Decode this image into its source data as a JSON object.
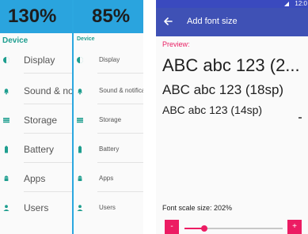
{
  "left_panels": [
    {
      "scale_label": "130%",
      "section": "Device",
      "items": [
        {
          "label": "Display",
          "icon": "brightness-icon"
        },
        {
          "label": "Sound & notification",
          "icon": "bell-icon"
        },
        {
          "label": "Storage",
          "icon": "storage-icon"
        },
        {
          "label": "Battery",
          "icon": "battery-icon"
        },
        {
          "label": "Apps",
          "icon": "android-icon"
        },
        {
          "label": "Users",
          "icon": "person-icon"
        }
      ]
    },
    {
      "scale_label": "85%",
      "section": "Device",
      "items": [
        {
          "label": "Display",
          "icon": "brightness-icon"
        },
        {
          "label": "Sound & notification",
          "icon": "bell-icon"
        },
        {
          "label": "Storage",
          "icon": "storage-icon"
        },
        {
          "label": "Battery",
          "icon": "battery-icon"
        },
        {
          "label": "Apps",
          "icon": "android-icon"
        },
        {
          "label": "Users",
          "icon": "person-icon"
        }
      ]
    }
  ],
  "phone": {
    "status_time": "12:0",
    "title": "Add font size",
    "preview_label": "Preview:",
    "samples": {
      "large": "ABC abc 123 (2...",
      "medium": "ABC abc 123 (18sp)",
      "small": "ABC abc 123 (14sp)"
    },
    "scale_text": "Font scale size:  202%",
    "minus_label": "-",
    "plus_label": "+",
    "slider_value": 0.2
  },
  "colors": {
    "header_blue": "#2aa4de",
    "teal_accent": "#1e9e8f",
    "indigo_primary": "#3f51b5",
    "pink_accent": "#ec1c63"
  }
}
